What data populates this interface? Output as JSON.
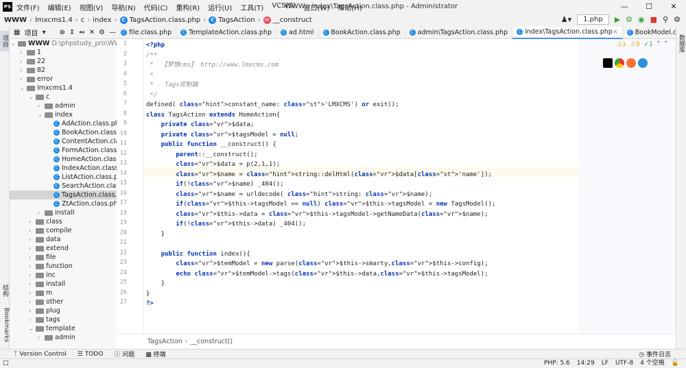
{
  "window": {
    "title": "WWW - index\\TagsAction.class.php - Administrator"
  },
  "menu": [
    "文件(F)",
    "编辑(E)",
    "视图(V)",
    "导航(N)",
    "代码(C)",
    "重构(R)",
    "运行(U)",
    "工具(T)",
    "VCS(S)",
    "窗口(W)",
    "帮助(H)"
  ],
  "breadcrumb": [
    "WWW",
    "lmxcms1.4",
    "c",
    "index",
    "TagsAction.class.php",
    "TagsAction",
    "__construct"
  ],
  "run_config": "1.php",
  "project_panel": {
    "label": "项目",
    "root_name": "WWW",
    "root_path": "D:\\phpstudy_pro\\WWW"
  },
  "tree": [
    {
      "level": 1,
      "name": "1",
      "kind": "folder",
      "expanded": false
    },
    {
      "level": 1,
      "name": "22",
      "kind": "folder",
      "expanded": false
    },
    {
      "level": 1,
      "name": "82",
      "kind": "folder",
      "expanded": false
    },
    {
      "level": 1,
      "name": "error",
      "kind": "folder",
      "expanded": false
    },
    {
      "level": 1,
      "name": "lmxcms1.4",
      "kind": "folder",
      "expanded": true
    },
    {
      "level": 2,
      "name": "c",
      "kind": "folder",
      "expanded": true
    },
    {
      "level": 3,
      "name": "admin",
      "kind": "folder",
      "expanded": false
    },
    {
      "level": 3,
      "name": "index",
      "kind": "folder",
      "expanded": true
    },
    {
      "level": 4,
      "name": "AdAction.class.php",
      "kind": "file"
    },
    {
      "level": 4,
      "name": "BookAction.class.php",
      "kind": "file"
    },
    {
      "level": 4,
      "name": "ContentAction.class.php",
      "kind": "file"
    },
    {
      "level": 4,
      "name": "FormAction.class.php",
      "kind": "file"
    },
    {
      "level": 4,
      "name": "HomeAction.class.php",
      "kind": "file"
    },
    {
      "level": 4,
      "name": "IndexAction.class.php",
      "kind": "file"
    },
    {
      "level": 4,
      "name": "ListAction.class.php",
      "kind": "file"
    },
    {
      "level": 4,
      "name": "SearchAction.class.php",
      "kind": "file"
    },
    {
      "level": 4,
      "name": "TagsAction.class.php",
      "kind": "file",
      "selected": true
    },
    {
      "level": 4,
      "name": "ZtAction.class.php",
      "kind": "file"
    },
    {
      "level": 3,
      "name": "install",
      "kind": "folder",
      "expanded": false
    },
    {
      "level": 2,
      "name": "class",
      "kind": "folder",
      "expanded": false
    },
    {
      "level": 2,
      "name": "compile",
      "kind": "folder",
      "expanded": false
    },
    {
      "level": 2,
      "name": "data",
      "kind": "folder",
      "expanded": false
    },
    {
      "level": 2,
      "name": "extend",
      "kind": "folder",
      "expanded": false
    },
    {
      "level": 2,
      "name": "file",
      "kind": "folder",
      "expanded": false
    },
    {
      "level": 2,
      "name": "function",
      "kind": "folder",
      "expanded": false
    },
    {
      "level": 2,
      "name": "inc",
      "kind": "folder",
      "expanded": false
    },
    {
      "level": 2,
      "name": "install",
      "kind": "folder",
      "expanded": false
    },
    {
      "level": 2,
      "name": "m",
      "kind": "folder",
      "expanded": false
    },
    {
      "level": 2,
      "name": "other",
      "kind": "folder",
      "expanded": false
    },
    {
      "level": 2,
      "name": "plug",
      "kind": "folder",
      "expanded": false
    },
    {
      "level": 2,
      "name": "tags",
      "kind": "folder",
      "expanded": false
    },
    {
      "level": 2,
      "name": "template",
      "kind": "folder",
      "expanded": true
    },
    {
      "level": 3,
      "name": "admin",
      "kind": "folder",
      "expanded": false
    }
  ],
  "tabs": [
    {
      "label": "file.class.php",
      "active": false
    },
    {
      "label": "TemplateAction.class.php",
      "active": false
    },
    {
      "label": "ad.html",
      "active": false
    },
    {
      "label": "BookAction.class.php",
      "active": false
    },
    {
      "label": "admin\\TagsAction.class.php",
      "active": false
    },
    {
      "label": "index\\TagsAction.class.php",
      "active": true
    },
    {
      "label": "BookModel.class.php",
      "active": false
    }
  ],
  "inspections": {
    "warnings": "1",
    "weak_warnings": "9",
    "typos": "1"
  },
  "editor_breadcrumb": [
    "TagsAction",
    "__construct()"
  ],
  "code_lines": [
    "<?php",
    "/**",
    " *  【梦想cms】 http://www.lmxcms.com",
    " *",
    " *   Tags控制器",
    " */",
    "defined( constant_name: 'LMXCMS') or exit();",
    "class TagsAction extends HomeAction{",
    "    private $data;",
    "    private $tagsModel = null;",
    "    public function __construct() {",
    "        parent::__construct();",
    "        $data = p(2,1,1);",
    "        $name = string::delHtml($data['name']);",
    "        if(!$name) _404();",
    "        $name = urldecode( string: $name);",
    "        if($this->tagsModel == null) $this->tagsModel = new TagsModel();",
    "        $this->data = $this->tagsModel->getNameData($name);",
    "        if(!$this->data) _404();",
    "    }",
    "",
    "    public function index(){",
    "        $temModel = new parse($this->smarty,$this->config);",
    "        echo $temModel->tags($this->data,$this->tagsModel);",
    "    }",
    "}",
    "?>"
  ],
  "left_strip": {
    "project": "项目",
    "structure": "结构",
    "bookmarks": "Bookmarks"
  },
  "right_strip": {
    "database": "数据库"
  },
  "bottom_tools": [
    "Version Control",
    "TODO",
    "问题",
    "终端"
  ],
  "event_log": "事件日志",
  "status": {
    "php": "PHP: 5.6",
    "position": "14:29",
    "line_sep": "LF",
    "encoding": "UTF-8",
    "indent": "4 个空格"
  }
}
